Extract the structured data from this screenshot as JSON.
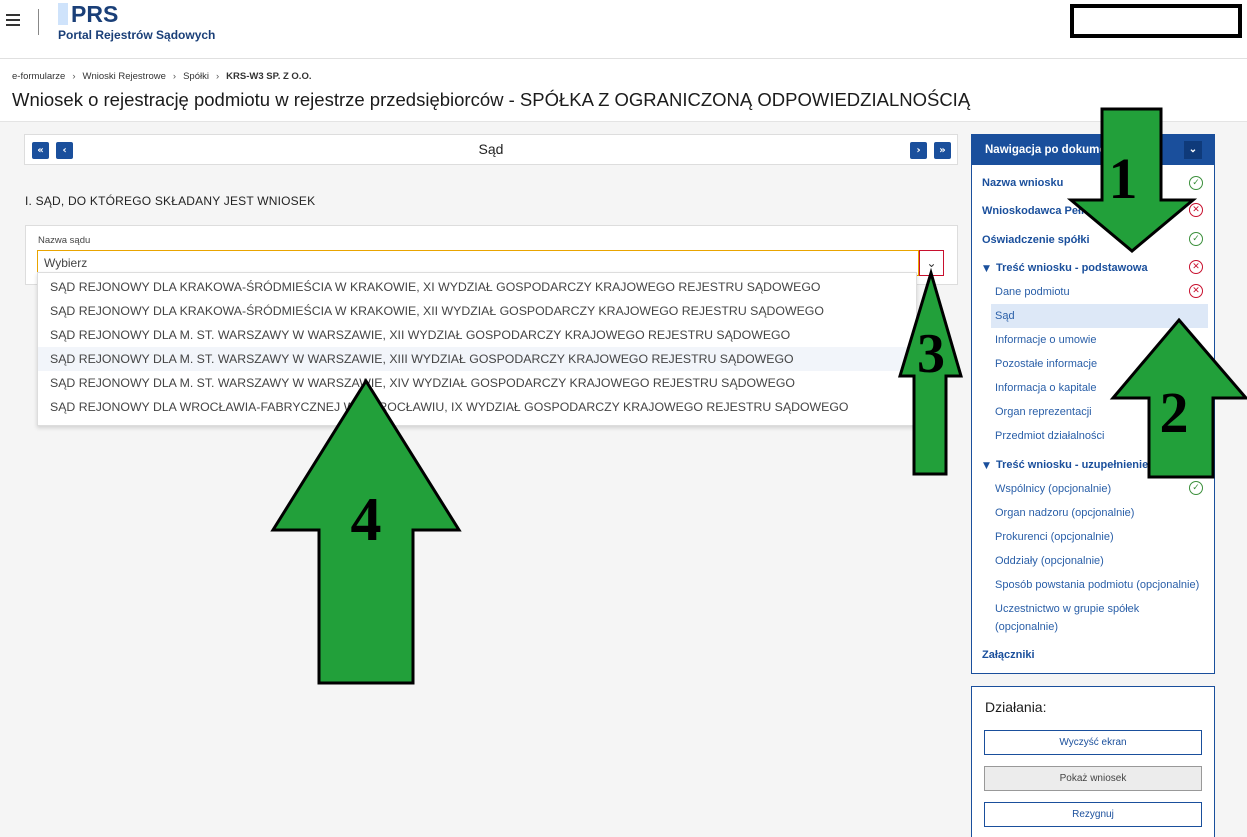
{
  "header": {
    "logo_title": "PRS",
    "logo_subtitle": "Portal Rejestrów Sądowych"
  },
  "breadcrumb": [
    "e-formularze",
    "Wnioski Rejestrowe",
    "Spółki",
    "KRS-W3 SP. Z O.O."
  ],
  "page_title": "Wniosek o rejestrację podmiotu w rejestrze przedsiębiorców - SPÓŁKA Z OGRANICZONĄ ODPOWIEDZIALNOŚCIĄ",
  "stepbar": {
    "title": "Sąd",
    "first": "«",
    "prev": "‹",
    "next": "›",
    "last": "»"
  },
  "section_heading": "I. SĄD, DO KTÓREGO SKŁADANY JEST WNIOSEK",
  "court_field": {
    "label": "Nazwa sądu",
    "placeholder": "Wybierz",
    "options": [
      "SĄD REJONOWY DLA KRAKOWA-ŚRÓDMIEŚCIA W KRAKOWIE, XI WYDZIAŁ GOSPODARCZY KRAJOWEGO REJESTRU SĄDOWEGO",
      "SĄD REJONOWY DLA KRAKOWA-ŚRÓDMIEŚCIA W KRAKOWIE, XII WYDZIAŁ GOSPODARCZY KRAJOWEGO REJESTRU SĄDOWEGO",
      "SĄD REJONOWY DLA M. ST. WARSZAWY W WARSZAWIE, XII WYDZIAŁ GOSPODARCZY KRAJOWEGO REJESTRU SĄDOWEGO",
      "SĄD REJONOWY DLA M. ST. WARSZAWY W WARSZAWIE, XIII WYDZIAŁ GOSPODARCZY KRAJOWEGO REJESTRU SĄDOWEGO",
      "SĄD REJONOWY DLA M. ST. WARSZAWY W WARSZAWIE, XIV WYDZIAŁ GOSPODARCZY KRAJOWEGO REJESTRU SĄDOWEGO",
      "SĄD REJONOWY DLA WROCŁAWIA-FABRYCZNEJ WE WROCŁAWIU, IX WYDZIAŁ GOSPODARCZY KRAJOWEGO REJESTRU SĄDOWEGO"
    ]
  },
  "nav_panel": {
    "title": "Nawigacja po dokume",
    "items": [
      {
        "label": "Nazwa wniosku",
        "status": "ok"
      },
      {
        "label": "Wnioskodawca Pełno",
        "status": "error"
      },
      {
        "label": "Oświadczenie spółki",
        "status": "ok"
      },
      {
        "label": "Treść wniosku - podstawowa",
        "status": "error"
      },
      {
        "label": "Dane podmiotu",
        "status": "error"
      },
      {
        "label": "Sąd",
        "status": "selected"
      },
      {
        "label": "Informacje o umowie"
      },
      {
        "label": "Pozostałe informacje"
      },
      {
        "label": "Informacja o kapitale"
      },
      {
        "label": "Organ reprezentacji"
      },
      {
        "label": "Przedmiot działalności"
      },
      {
        "label": "Treść wniosku - uzupełnienie"
      },
      {
        "label": "Wspólnicy (opcjonalnie)",
        "status": "ok"
      },
      {
        "label": "Organ nadzoru (opcjonalnie)"
      },
      {
        "label": "Prokurenci (opcjonalnie)"
      },
      {
        "label": "Oddziały (opcjonalnie)"
      },
      {
        "label": "Sposób powstania podmiotu (opcjonalnie)"
      },
      {
        "label": "Uczestnictwo w grupie spółek"
      },
      {
        "label": "(opcjonalnie)"
      },
      {
        "label": "Załączniki"
      }
    ]
  },
  "actions": {
    "title": "Działania:",
    "clear": "Wyczyść ekran",
    "show": "Pokaż wniosek",
    "cancel": "Rezygnuj"
  },
  "annotations": [
    "1",
    "2",
    "3",
    "4"
  ],
  "colors": {
    "primary": "#1a4f9c",
    "arrow_fill": "#22a03a",
    "error": "#c8102e",
    "ok": "#3b8f3b"
  }
}
